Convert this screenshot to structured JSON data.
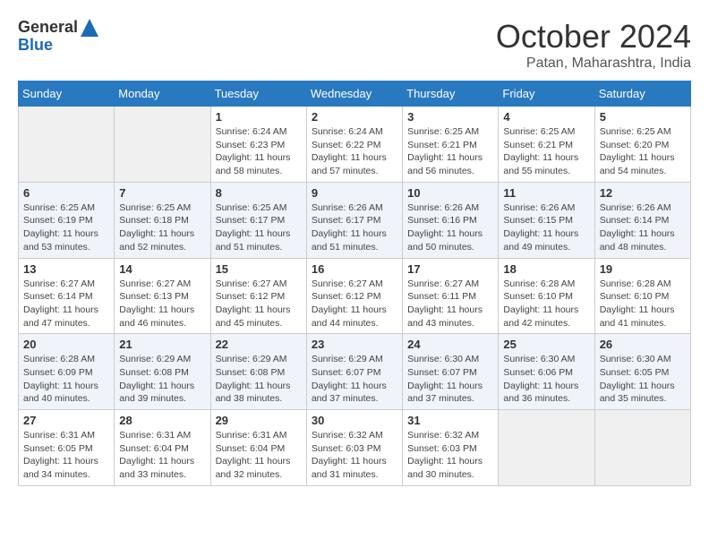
{
  "header": {
    "logo_line1": "General",
    "logo_line2": "Blue",
    "month": "October 2024",
    "location": "Patan, Maharashtra, India"
  },
  "weekdays": [
    "Sunday",
    "Monday",
    "Tuesday",
    "Wednesday",
    "Thursday",
    "Friday",
    "Saturday"
  ],
  "weeks": [
    [
      {
        "day": "",
        "info": ""
      },
      {
        "day": "",
        "info": ""
      },
      {
        "day": "1",
        "info": "Sunrise: 6:24 AM\nSunset: 6:23 PM\nDaylight: 11 hours and 58 minutes."
      },
      {
        "day": "2",
        "info": "Sunrise: 6:24 AM\nSunset: 6:22 PM\nDaylight: 11 hours and 57 minutes."
      },
      {
        "day": "3",
        "info": "Sunrise: 6:25 AM\nSunset: 6:21 PM\nDaylight: 11 hours and 56 minutes."
      },
      {
        "day": "4",
        "info": "Sunrise: 6:25 AM\nSunset: 6:21 PM\nDaylight: 11 hours and 55 minutes."
      },
      {
        "day": "5",
        "info": "Sunrise: 6:25 AM\nSunset: 6:20 PM\nDaylight: 11 hours and 54 minutes."
      }
    ],
    [
      {
        "day": "6",
        "info": "Sunrise: 6:25 AM\nSunset: 6:19 PM\nDaylight: 11 hours and 53 minutes."
      },
      {
        "day": "7",
        "info": "Sunrise: 6:25 AM\nSunset: 6:18 PM\nDaylight: 11 hours and 52 minutes."
      },
      {
        "day": "8",
        "info": "Sunrise: 6:25 AM\nSunset: 6:17 PM\nDaylight: 11 hours and 51 minutes."
      },
      {
        "day": "9",
        "info": "Sunrise: 6:26 AM\nSunset: 6:17 PM\nDaylight: 11 hours and 51 minutes."
      },
      {
        "day": "10",
        "info": "Sunrise: 6:26 AM\nSunset: 6:16 PM\nDaylight: 11 hours and 50 minutes."
      },
      {
        "day": "11",
        "info": "Sunrise: 6:26 AM\nSunset: 6:15 PM\nDaylight: 11 hours and 49 minutes."
      },
      {
        "day": "12",
        "info": "Sunrise: 6:26 AM\nSunset: 6:14 PM\nDaylight: 11 hours and 48 minutes."
      }
    ],
    [
      {
        "day": "13",
        "info": "Sunrise: 6:27 AM\nSunset: 6:14 PM\nDaylight: 11 hours and 47 minutes."
      },
      {
        "day": "14",
        "info": "Sunrise: 6:27 AM\nSunset: 6:13 PM\nDaylight: 11 hours and 46 minutes."
      },
      {
        "day": "15",
        "info": "Sunrise: 6:27 AM\nSunset: 6:12 PM\nDaylight: 11 hours and 45 minutes."
      },
      {
        "day": "16",
        "info": "Sunrise: 6:27 AM\nSunset: 6:12 PM\nDaylight: 11 hours and 44 minutes."
      },
      {
        "day": "17",
        "info": "Sunrise: 6:27 AM\nSunset: 6:11 PM\nDaylight: 11 hours and 43 minutes."
      },
      {
        "day": "18",
        "info": "Sunrise: 6:28 AM\nSunset: 6:10 PM\nDaylight: 11 hours and 42 minutes."
      },
      {
        "day": "19",
        "info": "Sunrise: 6:28 AM\nSunset: 6:10 PM\nDaylight: 11 hours and 41 minutes."
      }
    ],
    [
      {
        "day": "20",
        "info": "Sunrise: 6:28 AM\nSunset: 6:09 PM\nDaylight: 11 hours and 40 minutes."
      },
      {
        "day": "21",
        "info": "Sunrise: 6:29 AM\nSunset: 6:08 PM\nDaylight: 11 hours and 39 minutes."
      },
      {
        "day": "22",
        "info": "Sunrise: 6:29 AM\nSunset: 6:08 PM\nDaylight: 11 hours and 38 minutes."
      },
      {
        "day": "23",
        "info": "Sunrise: 6:29 AM\nSunset: 6:07 PM\nDaylight: 11 hours and 37 minutes."
      },
      {
        "day": "24",
        "info": "Sunrise: 6:30 AM\nSunset: 6:07 PM\nDaylight: 11 hours and 37 minutes."
      },
      {
        "day": "25",
        "info": "Sunrise: 6:30 AM\nSunset: 6:06 PM\nDaylight: 11 hours and 36 minutes."
      },
      {
        "day": "26",
        "info": "Sunrise: 6:30 AM\nSunset: 6:05 PM\nDaylight: 11 hours and 35 minutes."
      }
    ],
    [
      {
        "day": "27",
        "info": "Sunrise: 6:31 AM\nSunset: 6:05 PM\nDaylight: 11 hours and 34 minutes."
      },
      {
        "day": "28",
        "info": "Sunrise: 6:31 AM\nSunset: 6:04 PM\nDaylight: 11 hours and 33 minutes."
      },
      {
        "day": "29",
        "info": "Sunrise: 6:31 AM\nSunset: 6:04 PM\nDaylight: 11 hours and 32 minutes."
      },
      {
        "day": "30",
        "info": "Sunrise: 6:32 AM\nSunset: 6:03 PM\nDaylight: 11 hours and 31 minutes."
      },
      {
        "day": "31",
        "info": "Sunrise: 6:32 AM\nSunset: 6:03 PM\nDaylight: 11 hours and 30 minutes."
      },
      {
        "day": "",
        "info": ""
      },
      {
        "day": "",
        "info": ""
      }
    ]
  ]
}
